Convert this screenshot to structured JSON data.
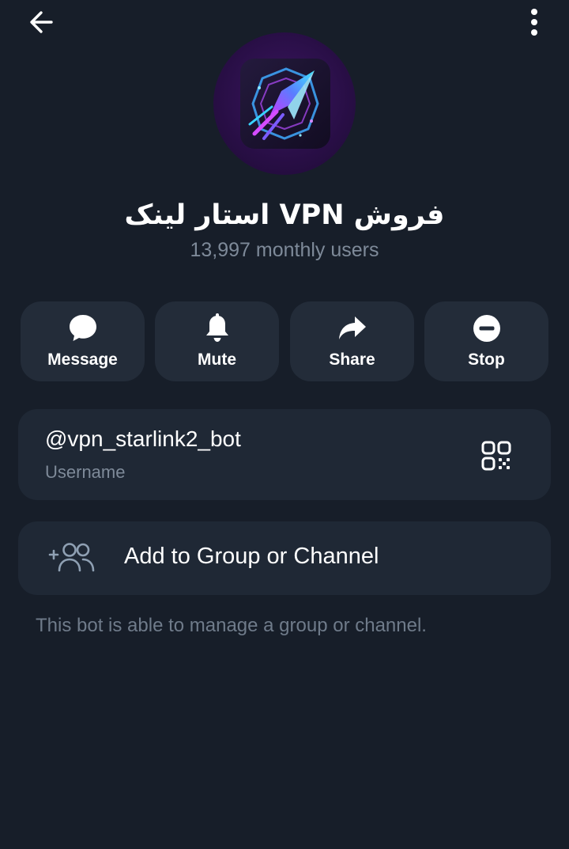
{
  "header": {
    "back_icon": "arrow-left-icon",
    "more_icon": "more-vertical-icon"
  },
  "profile": {
    "name": "فروش VPN استار لینک",
    "subtitle": "13,997 monthly users",
    "avatar_icon": "rocket-logo-icon"
  },
  "actions": [
    {
      "label": "Message",
      "icon": "chat-bubble-icon"
    },
    {
      "label": "Mute",
      "icon": "bell-icon"
    },
    {
      "label": "Share",
      "icon": "share-arrow-icon"
    },
    {
      "label": "Stop",
      "icon": "stop-icon"
    }
  ],
  "username": {
    "value": "@vpn_starlink2_bot",
    "caption": "Username",
    "qr_icon": "qr-code-icon"
  },
  "add_to_group": {
    "label": "Add to Group or Channel",
    "icon": "add-users-icon"
  },
  "note": "This bot is able to manage a group or channel.",
  "colors": {
    "background": "#171e29",
    "card": "#1f2835",
    "button": "#232c39",
    "muted_text": "#7e8a99"
  }
}
